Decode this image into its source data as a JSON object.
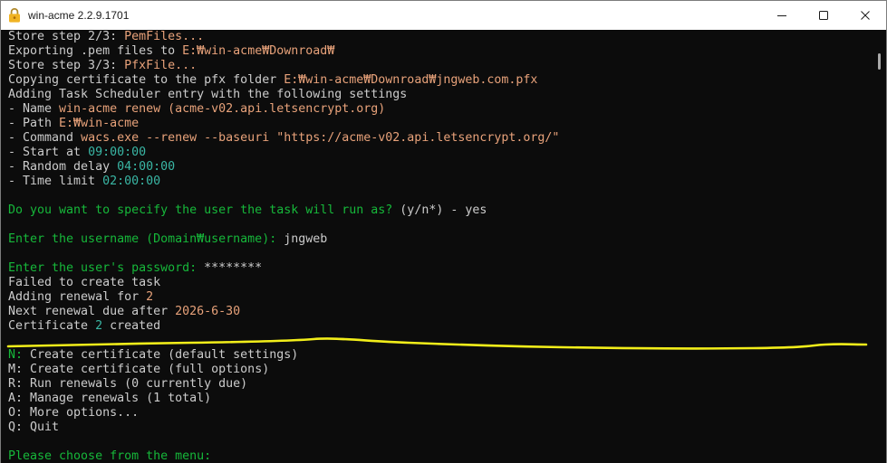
{
  "window": {
    "title": "win-acme 2.2.9.1701",
    "icon": "lock-icon",
    "controls": [
      "minimize-icon",
      "maximize-icon",
      "close-icon"
    ]
  },
  "colors": {
    "background": "#0c0c0c",
    "foreground": "#cccccc",
    "value": "#e8a27a",
    "number": "#3ab7a5",
    "prompt": "#16b83a",
    "titlebar": "#ffffff",
    "title_text": "#1b1b1b",
    "annotation": "#f2ee1a",
    "lock": "#f0b323",
    "scroll_thumb": "#a8a8a8"
  },
  "terminal": {
    "lines": [
      [
        "Store step 2/3: ",
        "PemFiles..."
      ],
      [
        "Exporting .pem files to ",
        "E:₩win-acme₩Downroad₩"
      ],
      [
        "Store step 3/3: ",
        "PfxFile..."
      ],
      [
        "Copying certificate to the pfx folder ",
        "E:₩win-acme₩Downroad₩jngweb.com.pfx"
      ],
      [
        "Adding Task Scheduler entry with the following settings"
      ],
      [
        "- Name ",
        "win-acme renew (acme-v02.api.letsencrypt.org)"
      ],
      [
        "- Path ",
        "E:₩win-acme"
      ],
      [
        "- Command ",
        "wacs.exe --renew --baseuri \"https://acme-v02.api.letsencrypt.org/\""
      ],
      [
        "- Start at ",
        "09:00:00"
      ],
      [
        "- Random delay ",
        "04:00:00"
      ],
      [
        "- Time limit ",
        "02:00:00"
      ],
      [
        "Do you want to specify the user the task will run as?",
        " (y/n*) - yes"
      ],
      [
        "Enter the username (Domain₩username):",
        " jngweb"
      ],
      [
        "Enter the user's password:",
        " ********"
      ],
      [
        "Failed to create task"
      ],
      [
        "Adding renewal for ",
        "2"
      ],
      [
        "Next renewal due after ",
        "2026-6-30"
      ],
      [
        "Certificate ",
        "2",
        " created"
      ]
    ],
    "menu": {
      "options": [
        {
          "key": "N:",
          "label": " Create certificate (default settings)"
        },
        {
          "key": "M:",
          "label": " Create certificate (full options)"
        },
        {
          "key": "R:",
          "label": " Run renewals (0 currently due)"
        },
        {
          "key": "A:",
          "label": " Manage renewals (1 total)"
        },
        {
          "key": "O:",
          "label": " More options..."
        },
        {
          "key": "Q:",
          "label": " Quit"
        }
      ],
      "prompt": "Please choose from the menu:"
    }
  }
}
